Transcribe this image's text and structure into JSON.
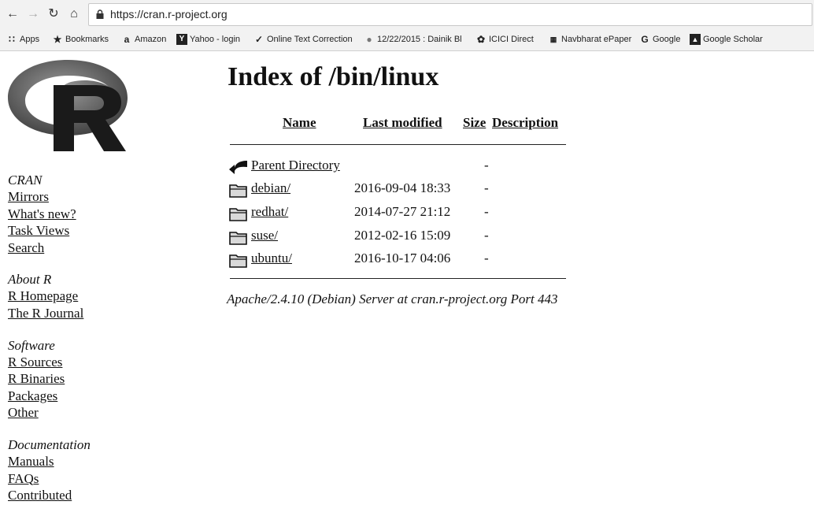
{
  "browser": {
    "url": "https://cran.r-project.org",
    "bookmarks": [
      {
        "label": "Apps",
        "icon": "apps-grid-icon"
      },
      {
        "label": "Bookmarks",
        "icon": "star-icon"
      },
      {
        "label": "Amazon",
        "icon": "amazon-icon"
      },
      {
        "label": "Yahoo - login",
        "icon": "yahoo-icon"
      },
      {
        "label": "Online Text Correction",
        "icon": "checkmark-icon"
      },
      {
        "label": "12/22/2015 : Dainik Bl",
        "icon": "circle-icon"
      },
      {
        "label": "ICICI Direct",
        "icon": "icici-icon"
      },
      {
        "label": "Navbharat ePaper",
        "icon": "newspaper-icon"
      },
      {
        "label": "Google",
        "icon": "google-icon"
      },
      {
        "label": "Google Scholar",
        "icon": "scholar-icon"
      }
    ]
  },
  "sidebar": {
    "sections": [
      {
        "heading": "CRAN",
        "links": [
          "Mirrors",
          "What's new?",
          "Task Views",
          "Search"
        ]
      },
      {
        "heading": "About R",
        "links": [
          "R Homepage",
          "The R Journal"
        ]
      },
      {
        "heading": "Software",
        "links": [
          "R Sources",
          "R Binaries",
          "Packages",
          "Other"
        ]
      },
      {
        "heading": "Documentation",
        "links": [
          "Manuals",
          "FAQs",
          "Contributed"
        ]
      }
    ]
  },
  "index": {
    "title": "Index of /bin/linux",
    "columns": {
      "name": "Name",
      "modified": "Last modified",
      "size": "Size",
      "description": "Description"
    },
    "rows": [
      {
        "name": "Parent Directory",
        "modified": "",
        "size": "-",
        "icon": "back-arrow-icon"
      },
      {
        "name": "debian/",
        "modified": "2016-09-04 18:33",
        "size": "-",
        "icon": "folder-icon"
      },
      {
        "name": "redhat/",
        "modified": "2014-07-27 21:12",
        "size": "-",
        "icon": "folder-icon"
      },
      {
        "name": "suse/",
        "modified": "2012-02-16 15:09",
        "size": "-",
        "icon": "folder-icon"
      },
      {
        "name": "ubuntu/",
        "modified": "2016-10-17 04:06",
        "size": "-",
        "icon": "folder-icon"
      }
    ],
    "server_signature": "Apache/2.4.10 (Debian) Server at cran.r-project.org Port 443"
  }
}
